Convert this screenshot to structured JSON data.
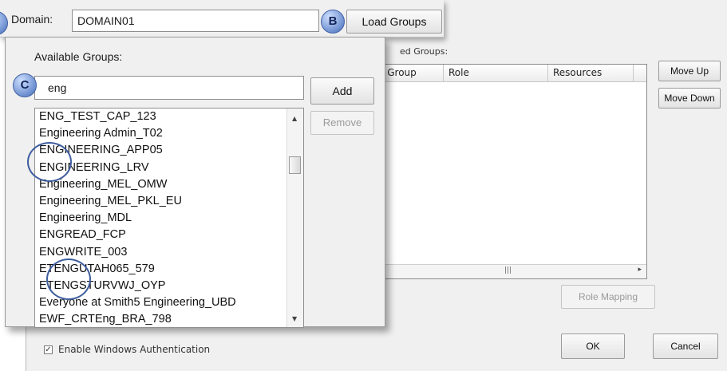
{
  "domain_bar": {
    "label": "Domain:",
    "value": "DOMAIN01",
    "load_button": "Load Groups"
  },
  "markers": {
    "b": "B",
    "c": "C"
  },
  "available": {
    "heading": "Available Groups:",
    "filter_value": "eng",
    "add_button": "Add",
    "remove_button": "Remove",
    "items": [
      "ENG_TEST_CAP_123",
      "Engineering Admin_T02",
      "ENGINEERING_APP05",
      "ENGINEERING_LRV",
      "Engineering_MEL_OMW",
      "Engineering_MEL_PKL_EU",
      "Engineering_MDL",
      "ENGREAD_FCP",
      "ENGWRITE_003",
      "ETENGUTAH065_579",
      "ETENGSTURVWJ_OYP",
      "Everyone at Smith5 Engineering_UBD",
      "EWF_CRTEng_BRA_798"
    ]
  },
  "mapped": {
    "heading_fragment": "ed Groups:",
    "columns": [
      "ows Group",
      "Role",
      "Resources"
    ],
    "move_up": "Move Up",
    "move_down": "Move Down",
    "role_mapping": "Role Mapping"
  },
  "footer": {
    "enable_windows_auth": "Enable Windows Authentication",
    "enable_windows_auth_checked": true,
    "ok": "OK",
    "cancel": "Cancel"
  },
  "icons": {
    "scroll_up": "scroll-up-arrow-icon",
    "scroll_down": "scroll-down-arrow-icon",
    "scroll_right": "scroll-right-arrow-icon",
    "checkmark": "checkmark-icon"
  }
}
